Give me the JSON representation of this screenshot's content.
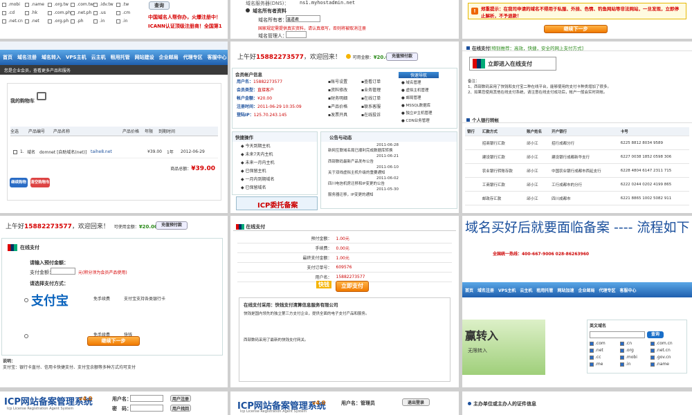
{
  "t1": {
    "tlds": [
      ".mobi",
      ".name",
      ".org.tw",
      ".com.tw",
      ".idv.tw",
      ".tw",
      ".cd",
      ".hk",
      ".com.ph",
      ".net.ph",
      ".us",
      ".cm",
      ".net.cn",
      ".net",
      ".org.ph",
      ".ph",
      ".in",
      ".in"
    ],
    "search": "查询",
    "notice1": "中国域名人帮你办，火爆注册中！",
    "notice2": "ICANN认证顶级注册商！全国第1"
  },
  "t2": {
    "dns_label": "域名服务器(DNS)：",
    "dns_value": "ns1.myhostadmin.net",
    "opt": "域名所有者资料",
    "owner_label": "域名所有者：",
    "owner_value": "温道君",
    "warn": "国家规定需提供真实资料，请认真填写，否则将被取消注册",
    "who_label": "域名管理人：",
    "who_value": ""
  },
  "t3": {
    "tip": "郑重提示：在我司申请的域名不得用于私服、外挂、色情、钓鱼网站等非法网站，一旦发现，立即停止解析，不予退款！",
    "btn": "继续下一步"
  },
  "t4": {
    "nav": [
      "首页",
      "域名注册",
      "域名转入",
      "VPS主机",
      "云主机",
      "租用托管",
      "网站建设",
      "企业邮局",
      "代理专区",
      "客服中心"
    ],
    "sub": "您是企业会员，查看更多产品和服务",
    "title": "我的购物车",
    "cols": [
      "全选",
      "产品编号",
      "产品名称",
      "产品价格",
      "年限",
      "到期时间"
    ],
    "row": {
      "no": "1.",
      "type": "域名",
      "name": "domnet [自助域名(net)]",
      "domain": "taihe8.net",
      "price": "¥39.00",
      "year": "1年",
      "date": "2012-06-29"
    },
    "total_label": "商品总额：",
    "total": "¥39.00",
    "btn1": "继续购物",
    "btn2": "清空购物车"
  },
  "t5": {
    "greet": "上午好",
    "phone": "15882273577",
    "welcome": "，欢迎回来！",
    "balance_label": "可用金额：",
    "balance": "¥20.00",
    "recharge": "充值预付款",
    "info_title": "会员帐户信息",
    "user_label": "用户名：",
    "user": "15882273577",
    "level_label": "会员类型：",
    "level": "直接客户",
    "amount_label": "帐户金额：",
    "amount": "¥20.00",
    "reg_label": "注册时间：",
    "reg": "2011-06-29 10:35:09",
    "ip_label": "登陆IP：",
    "ip": "125.70.243.145",
    "links": [
      "账号设置",
      "资料修改",
      "财务明细",
      "产品价格",
      "发票开具"
    ],
    "links2": [
      "查看订单",
      "业务管理",
      "在线订单",
      "联系客服",
      "在线投诉"
    ],
    "quick": "快速导航",
    "svcs": [
      "域名管理",
      "虚拟主机管理",
      "邮局管理",
      "MSSQL数据库",
      "独立IP主机管理",
      "CDN业务管理"
    ],
    "ops_title": "快捷操作",
    "ops": [
      "今天到期主机",
      "未来7天内主机",
      "未来一月内主机",
      "已保留主机",
      "一月内到期域名",
      "已保留域名"
    ],
    "news_title": "公告与动态",
    "news": [
      [
        "2011-06-28",
        "新网互联域名局已顺利完成数据库转换"
      ],
      [
        "2011-06-21",
        "西部数码最新产品发布公告"
      ],
      [
        "2011-06-10",
        "关于双线虚拟主机升级的重要通知"
      ],
      [
        "2011-06-02",
        "四川电信机房迁移和IP变更的公告"
      ],
      [
        "2011-05-30",
        "服务器迁移，IP变更的通知"
      ]
    ],
    "icp": "ICP委托备案"
  },
  "t6": {
    "title": "在线支付",
    "sub": "[特别推荐：高效，快捷，安全的网上支付方式]",
    "btn": "立即进入在线支付",
    "note": "备注：",
    "notes": [
      "1、西部数码采用了快钱和支付宝二种在线平台，能够使用的支付卡种类增加了很多。",
      "2、如果您使用其他在线支付系统，请注意在线支付成功后，帐户一般会实时到帐。"
    ],
    "bank_title": "个人银行转帐",
    "bank_cols": [
      "银行",
      "汇款方式",
      "账户姓名",
      "开户银行",
      "卡号"
    ],
    "banks": [
      [
        "",
        "招商银行汇款",
        "邱小江",
        "招行成都分行",
        "6225 8812 8034 9589"
      ],
      [
        "",
        "建设银行汇款",
        "邱小江",
        "建设银行成都新华支行",
        "6227 0038 1852 0598 306"
      ],
      [
        "",
        "农业银行转账存款",
        "邱小江",
        "中国农业银行成都市西延支行",
        "6228 4804 6147 2311 715"
      ],
      [
        "",
        "工商银行汇款",
        "邱小江",
        "工行成都市的分行",
        "6222 0244 0202 4199 865"
      ],
      [
        "",
        "邮政存汇款",
        "邱小江",
        "四川成都市",
        "6221 8865 1002 5082 911"
      ]
    ]
  },
  "t7": {
    "greet": "上午好",
    "phone": "15882273577",
    "welcome": "，欢迎回来！",
    "balance_label": "可使用金额：",
    "balance": "¥20.00",
    "recharge": "充值预付款",
    "title": "在线支付",
    "step1": "请输入预付金额：",
    "pay_label": "支付金额：",
    "unit": "元(积分须为会员产品使用)",
    "step2": "请选择支付方式：",
    "alipay": "支付宝",
    "free": "免手续费",
    "alipay_desc": "支付宝支持各类银行卡",
    "kuaiqian": "快钱",
    "btn": "继续下一步",
    "note_title": "说明：",
    "note": "支付宝：银行卡直付、信用卡快捷支付、支付宝余额等多种方式均可支付"
  },
  "t8": {
    "title": "在线支付",
    "rows": [
      [
        "预付金额：",
        "1.00元"
      ],
      [
        "手续费：",
        "0.00元"
      ],
      [
        "最终支付金额：",
        "1.00元"
      ],
      [
        "支付订单号：",
        "609576"
      ],
      [
        "用户名：",
        "15882273577"
      ]
    ],
    "btn": "立即支付",
    "kq": "快钱",
    "box_title": "在线支付采用：快钱支付清算信息服务有限公司",
    "body": "快钱是国内领先的独立第三方支付企业，提供全面的电子支付产品和服务。",
    "foot": "西部数码采用了最新的快钱支付网关。"
  },
  "t9": {
    "title": "域名买好后就要面临备案 ---- 流程如下",
    "hotline": "全国统一热线：400-667-9006",
    "phone2": "028-86263960",
    "nav": [
      "首页",
      "域名注册",
      "VPS主机",
      "云主机",
      "租用托管",
      "网站加速",
      "企业邮局",
      "代理专区",
      "客服中心"
    ],
    "banner": "赢转入",
    "banner2": "无限转入",
    "search_title": "英文域名",
    "search_btn": "查询",
    "tlds": [
      ".com",
      ".cn",
      ".com.cn",
      ".net",
      ".org",
      ".net.cn",
      ".cc",
      ".mobi",
      ".gov.cn",
      ".me",
      ".in",
      ".name"
    ]
  },
  "t10": {
    "icp": "ICP网站备案管理系统",
    "ver": "v4.0",
    "en": "Icp License Registration Agent System",
    "user_label": "用户名：",
    "pass_label": "密　码：",
    "reg": "用户注册",
    "find": "用户找回"
  },
  "t11": {
    "icp": "ICP网站备案管理系统",
    "ver": "v4.0",
    "en": "Icp License Registration Agent System",
    "user_label": "用户名：",
    "user": "管理员",
    "logout": "退出登录"
  },
  "t12": {
    "title": "主办单位或主办人的证件信息"
  }
}
